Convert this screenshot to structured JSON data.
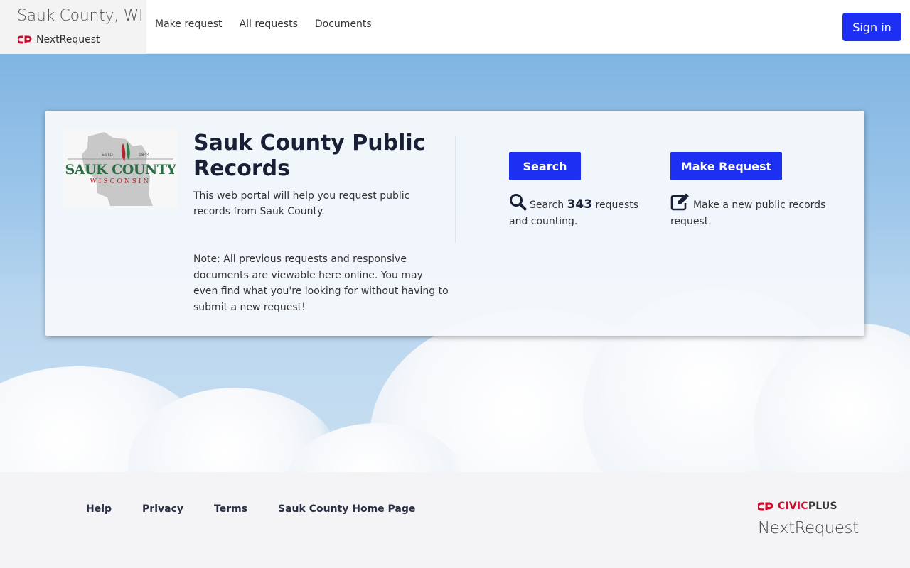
{
  "header": {
    "brand_title": "Sauk County, WI",
    "brand_sub": "NextRequest",
    "nav": [
      "Make request",
      "All requests",
      "Documents"
    ],
    "signin_label": "Sign in"
  },
  "card": {
    "logo_estd": "ESTD",
    "logo_year": "1844",
    "logo_main": "SAUK COUNTY",
    "logo_sub": "WISCONSIN",
    "title": "Sauk County Public Records",
    "desc": "This web portal will help you request public records from Sauk County.",
    "note": "Note: All previous requests and responsive documents are viewable here online. You may even find what you're looking for without having to submit a new request!",
    "search_label": "Search",
    "search_caption_pre": "Search",
    "search_count": "343",
    "search_caption_post": "requests and counting.",
    "make_label": "Make Request",
    "make_caption": "Make a new public records request."
  },
  "footer": {
    "links": [
      "Help",
      "Privacy",
      "Terms",
      "Sauk County Home Page"
    ],
    "civic_a": "CIVIC",
    "civic_b": "PLUS",
    "next_request": "NextRequest"
  },
  "colors": {
    "accent": "#1d2ff2",
    "civic_red": "#c8102e",
    "title_dark": "#1a1f36"
  }
}
